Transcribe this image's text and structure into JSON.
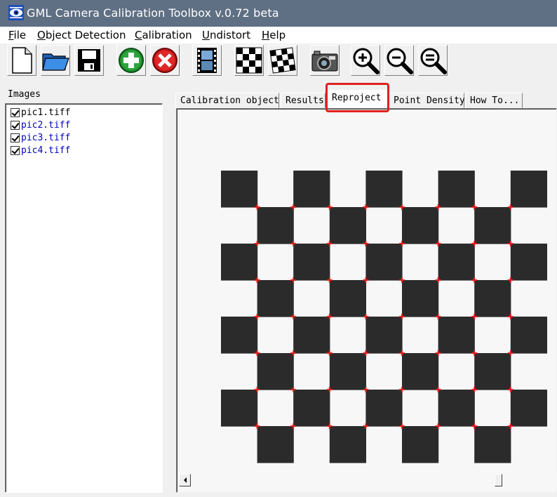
{
  "window": {
    "title": "GML Camera Calibration Toolbox  v.0.72 beta"
  },
  "menu": [
    {
      "mnemonic": "F",
      "rest": "ile"
    },
    {
      "mnemonic": "O",
      "rest": "bject Detection"
    },
    {
      "mnemonic": "C",
      "rest": "alibration"
    },
    {
      "mnemonic": "U",
      "rest": "ndistort"
    },
    {
      "mnemonic": "H",
      "rest": "elp"
    }
  ],
  "toolbar": {
    "icons": [
      "new-file-icon",
      "open-folder-icon",
      "save-disk-icon",
      "add-icon",
      "remove-icon",
      "film-icon",
      "checkerboard-icon",
      "checkerboard-detect-icon",
      "camera-icon",
      "zoom-in-icon",
      "zoom-out-icon",
      "zoom-fit-icon"
    ]
  },
  "images": {
    "label": "Images",
    "items": [
      {
        "name": "pic1.tiff",
        "checked": true
      },
      {
        "name": "pic2.tiff",
        "checked": true
      },
      {
        "name": "pic3.tiff",
        "checked": true
      },
      {
        "name": "pic4.tiff",
        "checked": true
      }
    ]
  },
  "tabs": [
    {
      "label": "Calibration object",
      "active": false
    },
    {
      "label": "Results",
      "active": false
    },
    {
      "label": "Reproject",
      "active": true
    },
    {
      "label": "Point Density",
      "active": false
    },
    {
      "label": "How To...",
      "active": false
    }
  ],
  "colors": {
    "titlebar": "#5f6f84",
    "highlight": "#e02020",
    "reprojection_points": "#e02020",
    "square": "#2b2b2b",
    "image_link": "#0000c0"
  },
  "checkerboard": {
    "rows": 8,
    "cols": 9
  }
}
